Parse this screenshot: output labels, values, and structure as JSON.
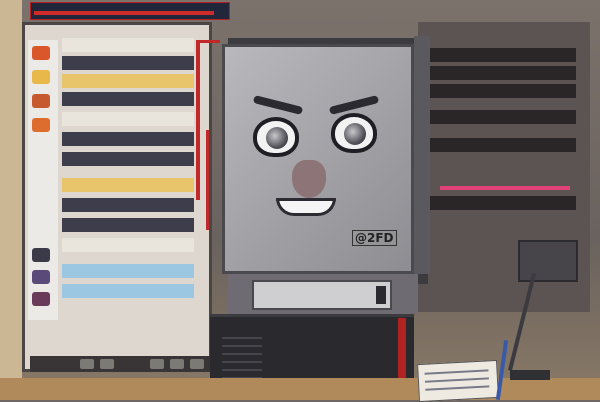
{
  "colors": {
    "backdrop": "#6f6763",
    "robot_face": "#b9b8bc",
    "accent_red": "#c0282a",
    "screen_dark": "#3d3d4b",
    "highlight": "#e8c56a"
  },
  "face_label": "@2FD",
  "icons": [
    "computer-icon",
    "face-icon",
    "monitor-icon",
    "wire-icon",
    "notepad-icon",
    "lamp-icon"
  ]
}
